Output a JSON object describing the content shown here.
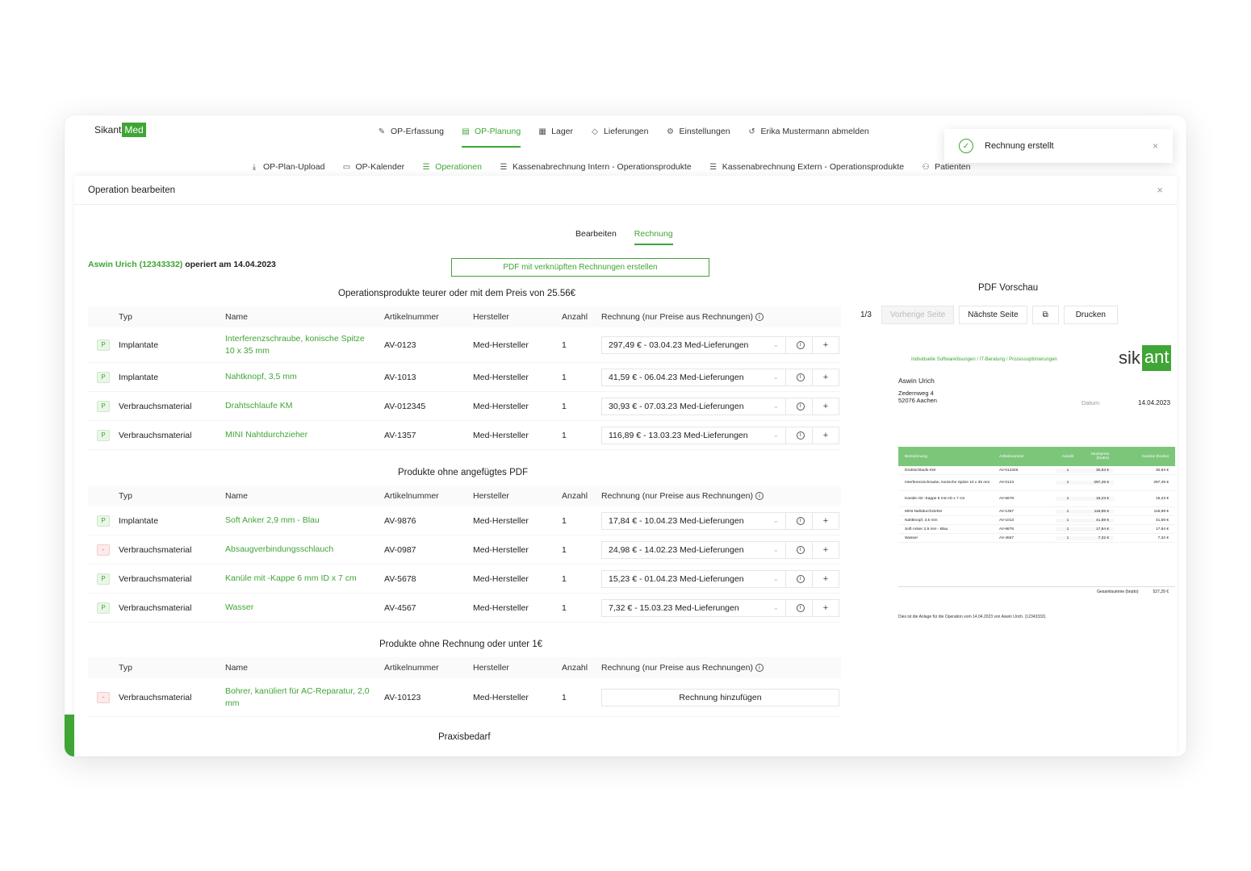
{
  "logo": {
    "part1": "Sikant",
    "part2": "Med"
  },
  "nav_main": [
    {
      "icon": "✎",
      "label": "OP-Erfassung"
    },
    {
      "icon": "▤",
      "label": "OP-Planung",
      "active": true
    },
    {
      "icon": "▦",
      "label": "Lager"
    },
    {
      "icon": "◇",
      "label": "Lieferungen"
    },
    {
      "icon": "⚙",
      "label": "Einstellungen"
    },
    {
      "icon": "↺",
      "label": "Erika Mustermann abmelden"
    }
  ],
  "nav_sub": [
    {
      "icon": "⤓",
      "label": "OP-Plan-Upload"
    },
    {
      "icon": "▭",
      "label": "OP-Kalender"
    },
    {
      "icon": "☰",
      "label": "Operationen",
      "active": true
    },
    {
      "icon": "☰",
      "label": "Kassenabrechnung Intern - Operationsprodukte"
    },
    {
      "icon": "☰",
      "label": "Kassenabrechnung Extern - Operationsprodukte"
    },
    {
      "icon": "⚇",
      "label": "Patienten"
    }
  ],
  "toast": {
    "message": "Rechnung erstellt",
    "close": "×"
  },
  "modal": {
    "title": "Operation bearbeiten",
    "close": "×",
    "tabs": [
      {
        "label": "Bearbeiten"
      },
      {
        "label": "Rechnung",
        "active": true
      }
    ],
    "patient_name": "Aswin Urich (12343332)",
    "patient_suffix": " operiert am 14.04.2023",
    "pdf_button": "PDF mit verknüpften Rechnungen erstellen"
  },
  "columns": {
    "typ": "Typ",
    "name": "Name",
    "artikel": "Artikelnummer",
    "hersteller": "Hersteller",
    "anzahl": "Anzahl",
    "rechnung": "Rechnung (nur Preise aus Rechnungen)"
  },
  "section1": {
    "title": "Operationsprodukte teurer oder mit dem Preis von 25.56€",
    "rows": [
      {
        "badge": "P",
        "typ": "Implantate",
        "name": "Interferenzschraube, konische Spitze 10 x 35 mm",
        "artikel": "AV-0123",
        "hersteller": "Med-Hersteller",
        "anzahl": "1",
        "rechnung": "297,49 € - 03.04.23 Med-Lieferungen"
      },
      {
        "badge": "P",
        "typ": "Implantate",
        "name": "Nahtknopf, 3,5 mm",
        "artikel": "AV-1013",
        "hersteller": "Med-Hersteller",
        "anzahl": "1",
        "rechnung": "41,59 € - 06.04.23 Med-Lieferungen"
      },
      {
        "badge": "P",
        "typ": "Verbrauchsmaterial",
        "name": "Drahtschlaufe KM",
        "artikel": "AV-012345",
        "hersteller": "Med-Hersteller",
        "anzahl": "1",
        "rechnung": "30,93 € - 07.03.23 Med-Lieferungen"
      },
      {
        "badge": "P",
        "typ": "Verbrauchsmaterial",
        "name": "MINI Nahtdurchzieher",
        "artikel": "AV-1357",
        "hersteller": "Med-Hersteller",
        "anzahl": "1",
        "rechnung": "116,89 € - 13.03.23 Med-Lieferungen"
      }
    ]
  },
  "section2": {
    "title": "Produkte ohne angefügtes PDF",
    "rows": [
      {
        "badge": "P",
        "typ": "Implantate",
        "name": "Soft Anker 2,9 mm - Blau",
        "artikel": "AV-9876",
        "hersteller": "Med-Hersteller",
        "anzahl": "1",
        "rechnung": "17,84 € - 10.04.23 Med-Lieferungen"
      },
      {
        "badge": "-",
        "typ": "Verbrauchsmaterial",
        "name": "Absaugverbindungsschlauch",
        "artikel": "AV-0987",
        "hersteller": "Med-Hersteller",
        "anzahl": "1",
        "rechnung": "24,98 € - 14.02.23 Med-Lieferungen"
      },
      {
        "badge": "P",
        "typ": "Verbrauchsmaterial",
        "name": "Kanüle mit -Kappe 6 mm ID x 7 cm",
        "artikel": "AV-5678",
        "hersteller": "Med-Hersteller",
        "anzahl": "1",
        "rechnung": "15,23 € - 01.04.23 Med-Lieferungen"
      },
      {
        "badge": "P",
        "typ": "Verbrauchsmaterial",
        "name": "Wasser",
        "artikel": "AV-4567",
        "hersteller": "Med-Hersteller",
        "anzahl": "1",
        "rechnung": "7,32 € - 15.03.23 Med-Lieferungen"
      }
    ]
  },
  "section3": {
    "title": "Produkte ohne Rechnung oder unter 1€",
    "rows": [
      {
        "badge": "-",
        "typ": "Verbrauchsmaterial",
        "name": "Bohrer, kanüliert für AC-Reparatur, 2,0 mm",
        "artikel": "AV-10123",
        "hersteller": "Med-Hersteller",
        "anzahl": "1",
        "button": "Rechnung hinzufügen"
      }
    ]
  },
  "section4": {
    "title": "Praxisbedarf"
  },
  "pdf_preview": {
    "title": "PDF Vorschau",
    "page": "1/3",
    "prev": "Vorherige Seite",
    "next": "Nächste Seite",
    "copy_icon": "⧉",
    "print": "Drucken",
    "tagline": "Individuelle Softwarelösungen / IT-Beratung / Prozessoptimierungen",
    "logo_a": "sik",
    "logo_b": "ant",
    "addr_name": "Aswin Urich",
    "addr_street": "Zedernweg 4",
    "addr_city": "52076 Aachen",
    "date_label": "Datum",
    "date": "14.04.2023",
    "headers": [
      "Bezeichnung",
      "Artikelnummer",
      "Anzahl",
      "Stückpreis (brutto)",
      "Summe (brutto)"
    ],
    "rows": [
      [
        "Drahtschlaufe KM",
        "AV-012345",
        "1",
        "30,93 €",
        "30,93 €"
      ],
      [
        "Interferenzschraube, konische Spitze 10 x 35 mm",
        "AV-0123",
        "1",
        "297,49 €",
        "297,49 €"
      ],
      [
        "Kanüle mit -Kappe 6 mm ID x 7 cm",
        "AV-5678",
        "1",
        "15,23 €",
        "15,23 €"
      ],
      [
        "MINI Nahtdurchzieher",
        "AV-1357",
        "1",
        "116,89 €",
        "116,89 €"
      ],
      [
        "Nahtknopf, 3,5 mm",
        "AV-1013",
        "1",
        "41,59 €",
        "41,59 €"
      ],
      [
        "Soft Anker 2,9 mm - Blau",
        "AV-9876",
        "1",
        "17,84 €",
        "17,84 €"
      ],
      [
        "Wasser",
        "AV-4567",
        "1",
        "7,32 €",
        "7,32 €"
      ]
    ],
    "total_label": "Gesamtsumme (brutto)",
    "total": "527,29 €",
    "footer": "Dies ist die Anlage für die Operation vom 14.04.2023 von Aswin Urich. (12343332)."
  },
  "icons": {
    "info": "i",
    "plus": "+",
    "chevron": "⌄",
    "check": "✓"
  },
  "colors": {
    "accent": "#3fa535",
    "badge_red": "#e05252"
  }
}
